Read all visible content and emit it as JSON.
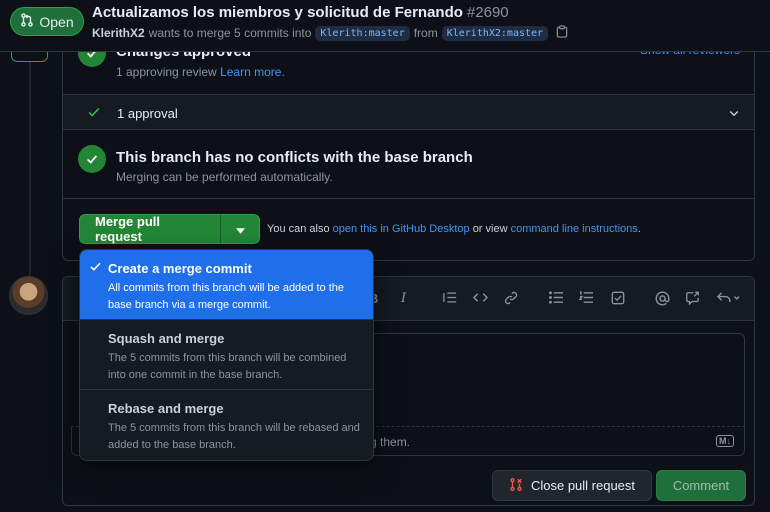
{
  "header": {
    "state": "Open",
    "title": "Actualizamos los miembros y solicitud de Fernando",
    "number": "#2690",
    "author": "KlerithX2",
    "meta_mid": "wants to merge 5 commits into",
    "base_branch": "Klerith:master",
    "meta_from": "from",
    "head_branch": "KlerithX2:master"
  },
  "merge_box": {
    "changes_title": "Changes approved",
    "approvals_text": "1 approving review",
    "learn_more": "Learn more.",
    "show_reviewers": "Show all reviewers",
    "approval_row": "1 approval",
    "conflict_title": "This branch has no conflicts with the base branch",
    "conflict_sub": "Merging can be performed automatically."
  },
  "merge_button": {
    "label": "Merge pull request",
    "also_prefix": "You can also",
    "desktop_link": "open this in GitHub Desktop",
    "or_view": "or view",
    "cli_link": "command line instructions",
    "period": "."
  },
  "merge_menu": {
    "items": [
      {
        "title": "Create a merge commit",
        "desc": "All commits from this branch will be added to the base branch via a merge commit.",
        "selected": true
      },
      {
        "title": "Squash and merge",
        "desc": "The 5 commits from this branch will be combined into one commit in the base branch.",
        "selected": false
      },
      {
        "title": "Rebase and merge",
        "desc": "The 5 commits from this branch will be rebased and added to the base branch.",
        "selected": false
      }
    ]
  },
  "comment": {
    "attach_text": "g them.",
    "close_label": "Close pull request",
    "comment_label": "Comment",
    "md_badge": "M↓"
  },
  "colors": {
    "green": "#238636",
    "accent_blue": "#1f6feb",
    "link": "#4493f8",
    "danger": "#f85149"
  }
}
